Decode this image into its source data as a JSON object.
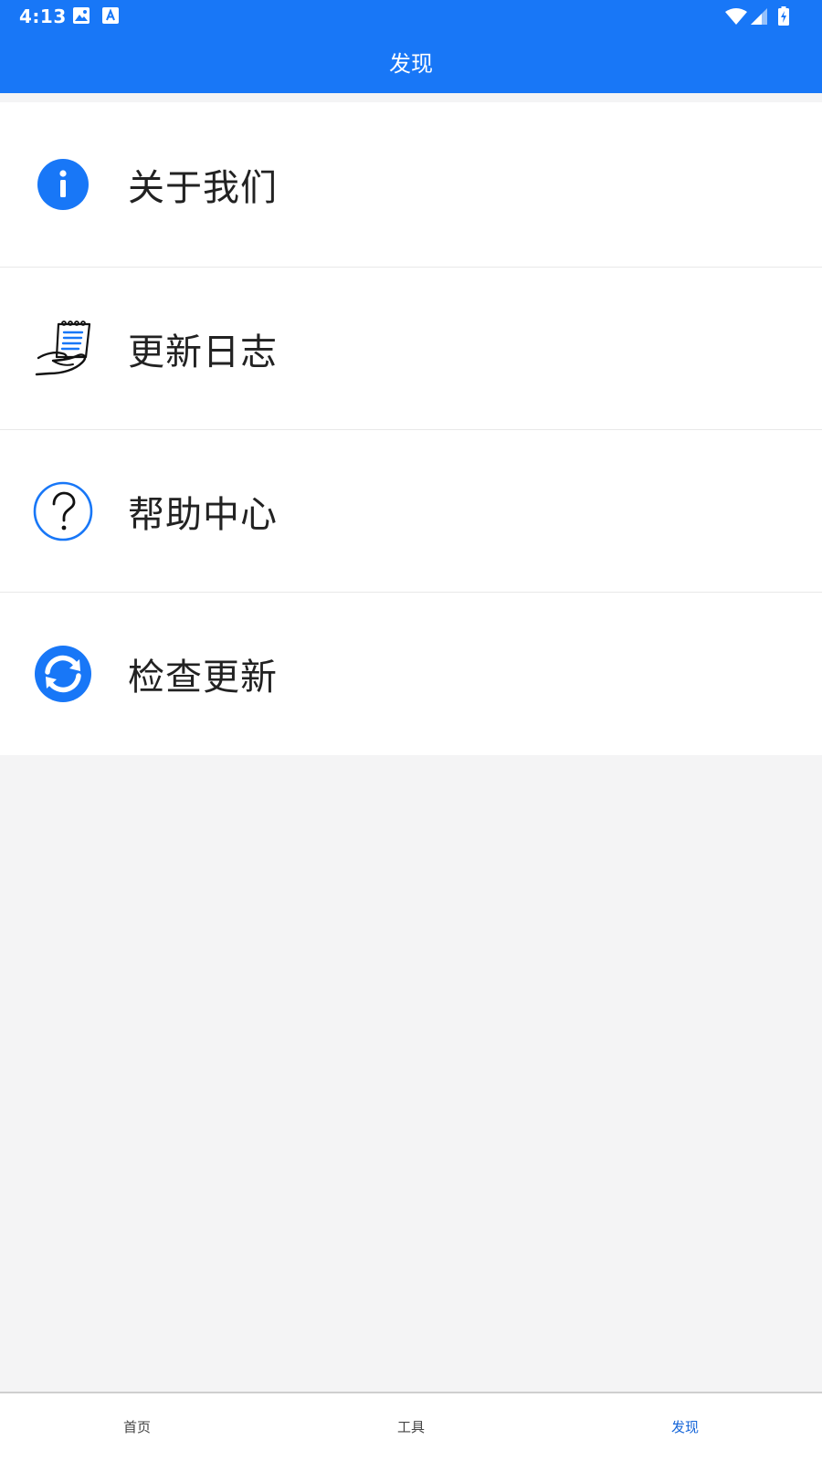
{
  "status_bar": {
    "time": "4:13"
  },
  "header": {
    "title": "发现"
  },
  "menu": {
    "items": [
      {
        "label": "关于我们",
        "icon": "info-icon"
      },
      {
        "label": "更新日志",
        "icon": "changelog-icon"
      },
      {
        "label": "帮助中心",
        "icon": "help-icon"
      },
      {
        "label": "检查更新",
        "icon": "refresh-icon"
      }
    ]
  },
  "bottom_nav": {
    "items": [
      {
        "label": "首页",
        "active": false
      },
      {
        "label": "工具",
        "active": false
      },
      {
        "label": "发现",
        "active": true
      }
    ]
  },
  "colors": {
    "primary": "#1877f7",
    "active_tab": "#1565d8",
    "background": "#f4f4f5"
  }
}
